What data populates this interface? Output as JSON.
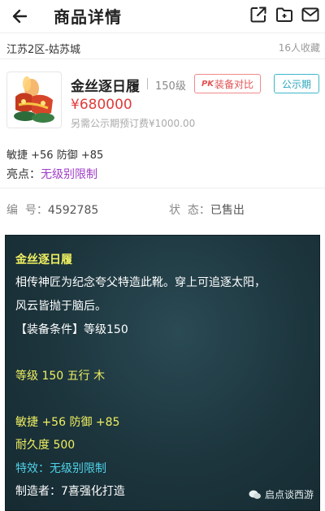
{
  "header": {
    "title": "商品详情"
  },
  "server": {
    "name": "江苏2区-姑苏城",
    "favorites": "16人收藏"
  },
  "item": {
    "name": "金丝逐日履",
    "level": "150级",
    "compare_label": "装备对比",
    "compare_prefix": "PK",
    "public_label": "公示期",
    "price": "¥680000",
    "fee_note": "另需公示期预订费¥1000.00"
  },
  "summary": {
    "stats": "敏捷 +56 防御 +85",
    "highlight_label": "亮点：",
    "highlight_value": "无级别限制"
  },
  "info": {
    "id_label": "编  号：",
    "id_value": "4592785",
    "status_label": "状  态：",
    "status_value": "已售出"
  },
  "detail": {
    "name": "金丝逐日履",
    "desc_line1": "相传神匠为纪念夸父特造此靴。穿上可追逐太阳，",
    "desc_line2": "风云皆抛于脑后。",
    "requirement": "【装备条件】等级150",
    "level_element": "等级 150 五行 木",
    "stats": "敏捷 +56 防御 +85",
    "durability": "耐久度 500",
    "effect_label": "特效：",
    "effect_value": "无级别限制",
    "maker": "制造者：7喜强化打造"
  },
  "watermark": "启点谈西游",
  "colors": {
    "price": "#e03b3b",
    "highlight": "#a03ec8",
    "public_badge": "#29a6ba",
    "compare": "#e25252",
    "panel_bg": "#1c343c",
    "panel_yellow": "#f0f060",
    "panel_cyan": "#4fd2e8"
  }
}
